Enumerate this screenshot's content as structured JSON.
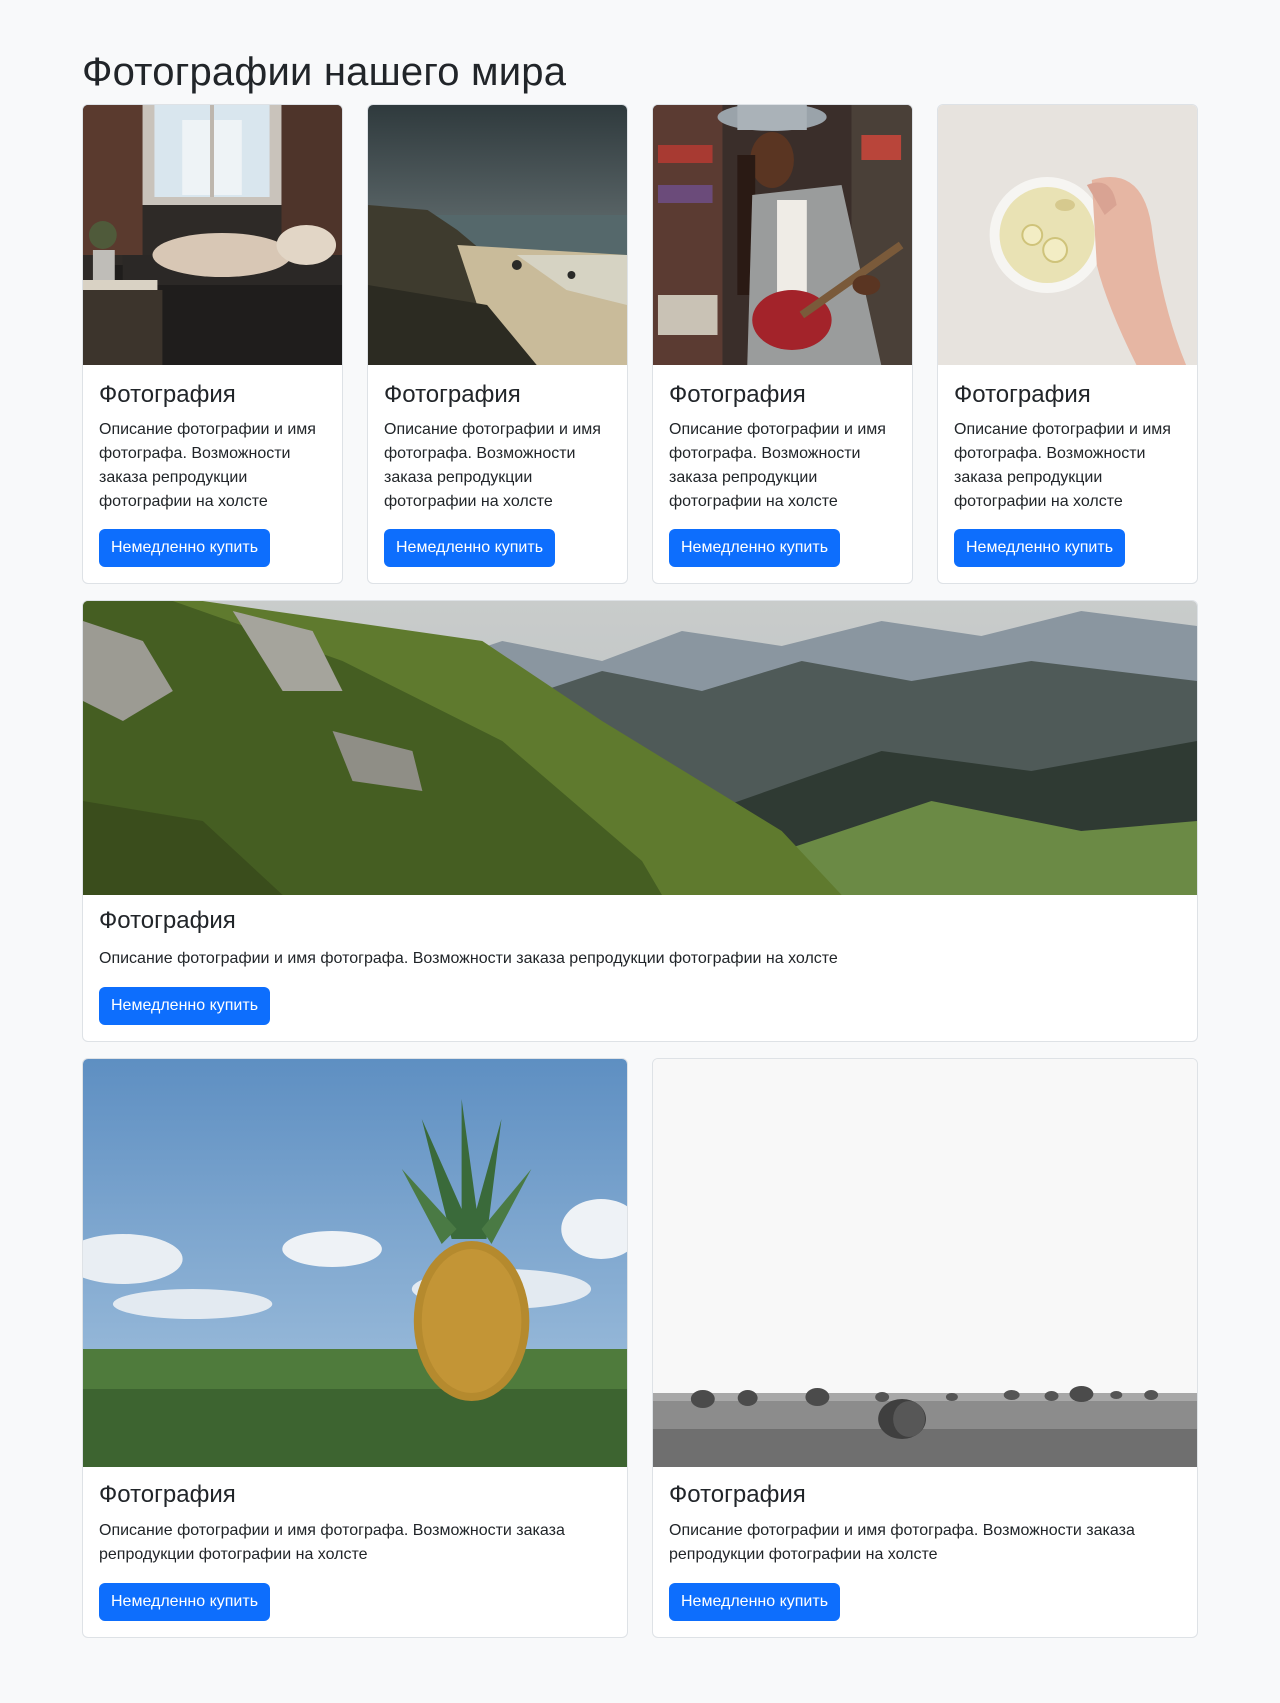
{
  "page": {
    "title": "Фотографии нашего мира"
  },
  "colors": {
    "accent": "#0d6efd",
    "background": "#f8f9fa",
    "card_border": "#dee2e6"
  },
  "cards": [
    {
      "image": "room-window-photo",
      "title": "Фотография",
      "description": "Описание фотографии и имя фотографа. Возможности заказа репродукции фотографии на холсте",
      "button": "Немедленно купить"
    },
    {
      "image": "stormy-beach-photo",
      "title": "Фотография",
      "description": "Описание фотографии и имя фотографа. Возможности заказа репродукции фотографии на холсте",
      "button": "Немедленно купить"
    },
    {
      "image": "guitarist-photo",
      "title": "Фотография",
      "description": "Описание фотографии и имя фотографа. Возможности заказа репродукции фотографии на холсте",
      "button": "Немедленно купить"
    },
    {
      "image": "lemon-tea-cup-photo",
      "title": "Фотография",
      "description": "Описание фотографии и имя фотографа. Возможности заказа репродукции фотографии на холсте",
      "button": "Немедленно купить"
    },
    {
      "image": "mountain-valley-photo",
      "title": "Фотография",
      "description": "Описание фотографии и имя фотографа. Возможности заказа репродукции фотографии на холсте",
      "button": "Немедленно купить"
    },
    {
      "image": "pineapple-grass-photo",
      "title": "Фотография",
      "description": "Описание фотографии и имя фотографа. Возможности заказа репродукции фотографии на холсте",
      "button": "Немедленно купить"
    },
    {
      "image": "hay-bales-field-photo",
      "title": "Фотография",
      "description": "Описание фотографии и имя фотографа. Возможности заказа репродукции фотографии на холсте",
      "button": "Немедленно купить"
    }
  ]
}
